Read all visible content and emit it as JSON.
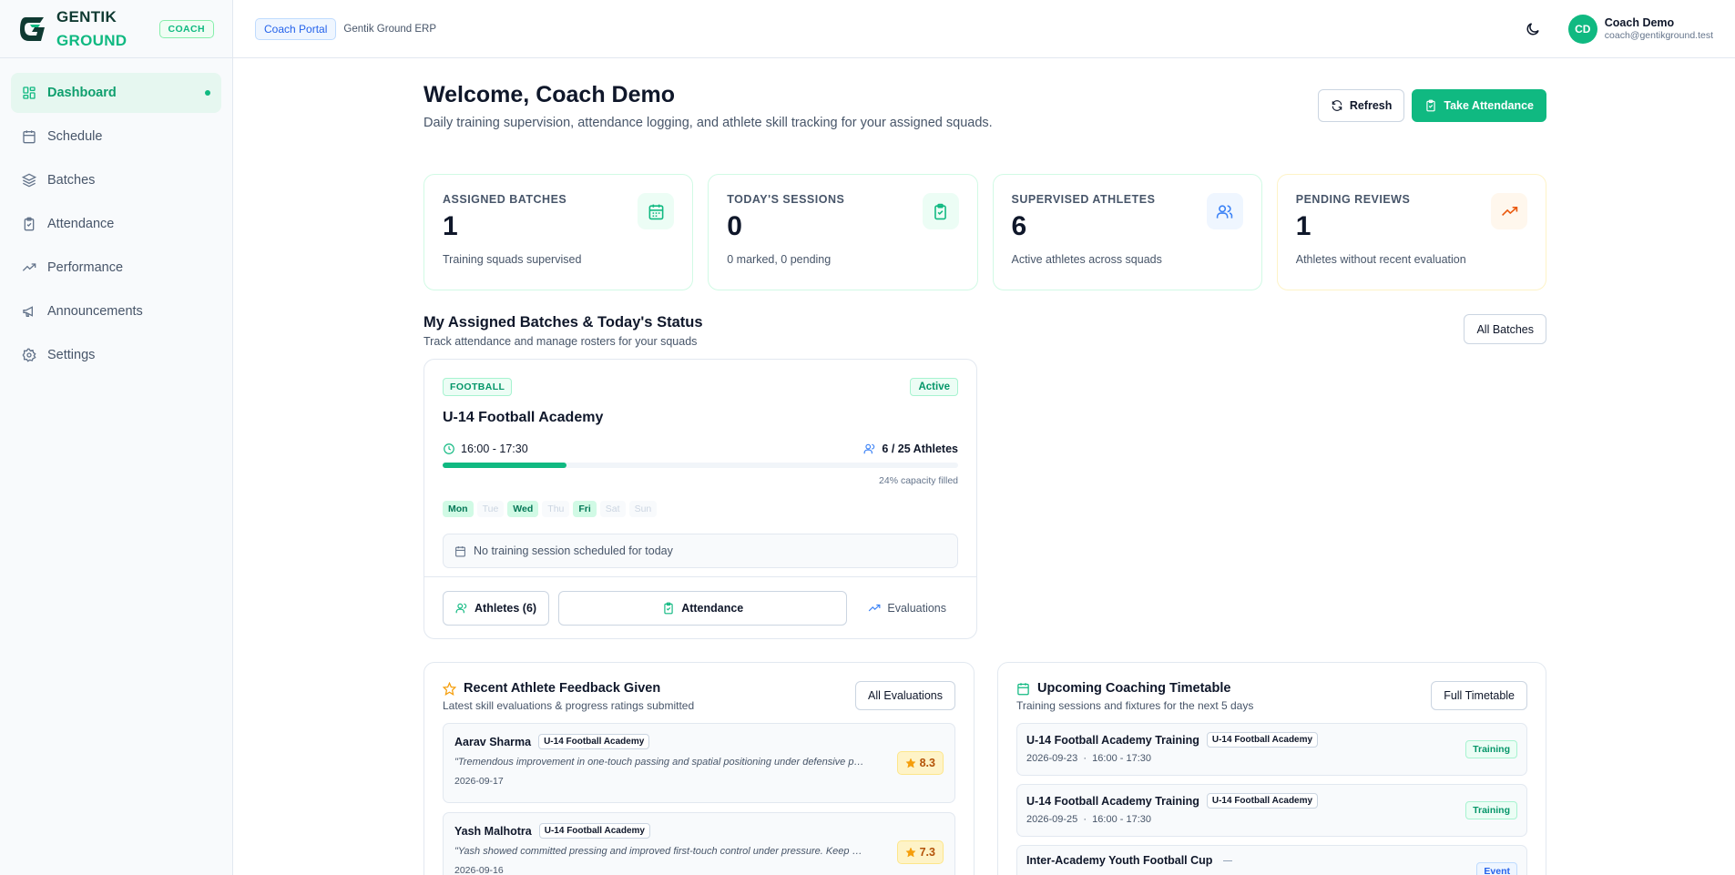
{
  "brand": {
    "line1": "GENTIK",
    "line2": "GROUND",
    "role": "COACH"
  },
  "sidebar": {
    "items": [
      {
        "label": "Dashboard",
        "icon": "dashboard-icon",
        "active": true
      },
      {
        "label": "Schedule",
        "icon": "calendar-icon"
      },
      {
        "label": "Batches",
        "icon": "layers-icon"
      },
      {
        "label": "Attendance",
        "icon": "clipboard-icon"
      },
      {
        "label": "Performance",
        "icon": "trend-icon"
      },
      {
        "label": "Announcements",
        "icon": "megaphone-icon"
      },
      {
        "label": "Settings",
        "icon": "gear-icon"
      }
    ]
  },
  "topbar": {
    "portal": "Coach Portal",
    "erp": "Gentik Ground ERP",
    "user": {
      "initials": "CD",
      "name": "Coach Demo",
      "email": "coach@gentikground.test"
    }
  },
  "header": {
    "title": "Welcome, Coach Demo",
    "subtitle": "Daily training supervision, attendance logging, and athlete skill tracking for your assigned squads.",
    "refresh": "Refresh",
    "take_attendance": "Take Attendance"
  },
  "stats": [
    {
      "label": "ASSIGNED BATCHES",
      "value": "1",
      "desc": "Training squads supervised",
      "icon": "calendar-icon",
      "color": "#10b981"
    },
    {
      "label": "TODAY'S SESSIONS",
      "value": "0",
      "desc": "0 marked, 0 pending",
      "icon": "clipboard-check-icon",
      "color": "#10b981"
    },
    {
      "label": "SUPERVISED ATHLETES",
      "value": "6",
      "desc": "Active athletes across squads",
      "icon": "users-icon",
      "color": "#3b82f6"
    },
    {
      "label": "PENDING REVIEWS",
      "value": "1",
      "desc": "Athletes without recent evaluation",
      "icon": "trend-icon",
      "color": "#f59e0b"
    }
  ],
  "batches_section": {
    "title": "My Assigned Batches & Today's Status",
    "subtitle": "Track attendance and manage rosters for your squads",
    "all_button": "All Batches"
  },
  "batch": {
    "sport": "FOOTBALL",
    "status": "Active",
    "name": "U-14 Football Academy",
    "time": "16:00 - 17:30",
    "athletes": "6 / 25 Athletes",
    "capacity_fraction": 0.24,
    "capacity_text": "24% capacity filled",
    "days": [
      {
        "label": "Mon",
        "on": true
      },
      {
        "label": "Tue",
        "on": false
      },
      {
        "label": "Wed",
        "on": true
      },
      {
        "label": "Thu",
        "on": false
      },
      {
        "label": "Fri",
        "on": true
      },
      {
        "label": "Sat",
        "on": false
      },
      {
        "label": "Sun",
        "on": false
      }
    ],
    "no_session": "No training session scheduled for today",
    "athletes_button": "Athletes (6)",
    "attendance_button": "Attendance",
    "evaluations_button": "Evaluations"
  },
  "feedback": {
    "title": "Recent Athlete Feedback Given",
    "subtitle": "Latest skill evaluations & progress ratings submitted",
    "button": "All Evaluations",
    "items": [
      {
        "name": "Aarav Sharma",
        "batch": "U-14 Football Academy",
        "quote": "\"Tremendous improvement in one-touch passing and spatial positioning under defensive pressure.\"",
        "date": "2026-09-17",
        "score": "8.3"
      },
      {
        "name": "Yash Malhotra",
        "batch": "U-14 Football Academy",
        "quote": "\"Yash showed committed pressing and improved first-touch control under pressure. Keep working.\"",
        "date": "2026-09-16",
        "score": "7.3"
      }
    ]
  },
  "timetable": {
    "title": "Upcoming Coaching Timetable",
    "subtitle": "Training sessions and fixtures for the next 5 days",
    "button": "Full Timetable",
    "items": [
      {
        "title": "U-14 Football Academy Training",
        "batch": "U-14 Football Academy",
        "date": "2026-09-23",
        "time": "16:00 - 17:30",
        "type": "Training"
      },
      {
        "title": "U-14 Football Academy Training",
        "batch": "U-14 Football Academy",
        "date": "2026-09-25",
        "time": "16:00 - 17:30",
        "type": "Training"
      },
      {
        "title": "Inter-Academy Youth Football Cup",
        "batch": "",
        "date": "",
        "time": "",
        "type": "Event"
      }
    ]
  }
}
